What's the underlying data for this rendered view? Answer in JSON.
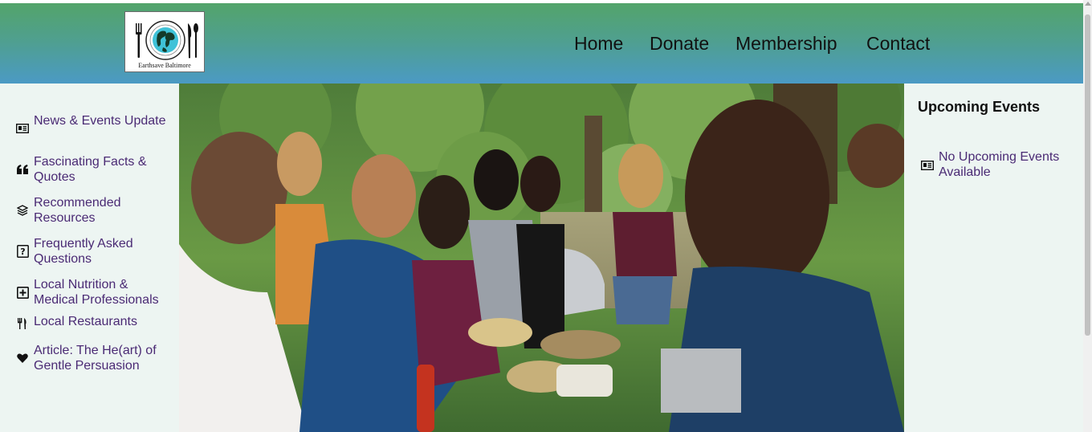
{
  "logo": {
    "text": "Earthsave Baltimore",
    "icon": "globe-plate-cutlery-logo"
  },
  "nav": [
    {
      "label": "Home"
    },
    {
      "label": "Donate"
    },
    {
      "label": "Membership"
    },
    {
      "label": "Contact"
    }
  ],
  "sidebar": {
    "items": [
      {
        "label": "News & Events Update",
        "icon": "newspaper-icon"
      },
      {
        "label": "Fascinating Facts & Quotes",
        "icon": "quote-icon"
      },
      {
        "label": "Recommended Resources",
        "icon": "layers-icon"
      },
      {
        "label": "Frequently Asked Questions",
        "icon": "question-icon"
      },
      {
        "label": "Local Nutrition & Medical Professionals",
        "icon": "medical-plus-icon"
      },
      {
        "label": "Local Restaurants",
        "icon": "utensils-icon"
      },
      {
        "label": "Article: The He(art) of Gentle Persuasion",
        "icon": "heart-icon"
      }
    ]
  },
  "events": {
    "title": "Upcoming Events",
    "items": [
      {
        "label": "No Upcoming Events Available",
        "icon": "newspaper-icon"
      }
    ]
  },
  "colors": {
    "header_top": "#53a46a",
    "header_bottom": "#4b9ac4",
    "link": "#4a2a74",
    "panel_bg": "#edf5f2"
  }
}
